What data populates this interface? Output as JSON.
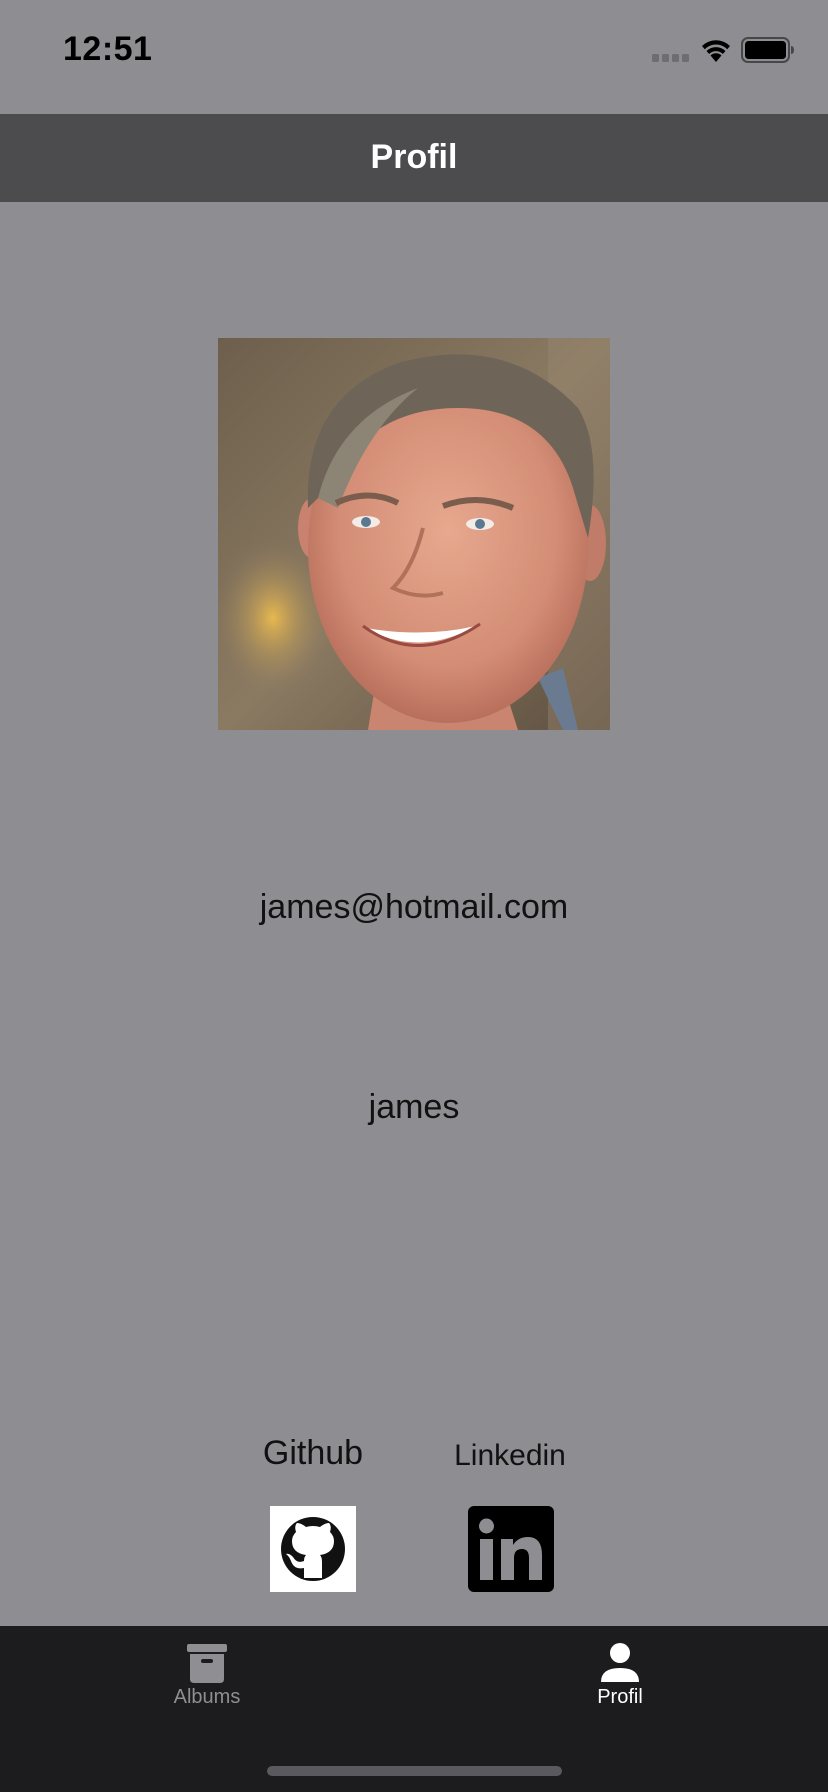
{
  "status_bar": {
    "time": "12:51"
  },
  "nav": {
    "title": "Profil"
  },
  "profile": {
    "email": "james@hotmail.com",
    "name": "james"
  },
  "social": {
    "github_label": "Github",
    "linkedin_label": "Linkedin"
  },
  "tabs": [
    {
      "label": "Albums",
      "icon": "archive-box-icon",
      "selected": false
    },
    {
      "label": "Profil",
      "icon": "person-icon",
      "selected": true
    }
  ],
  "colors": {
    "background": "#8e8d92",
    "nav_bar": "#4c4c4e",
    "tab_bar": "#1c1c1e",
    "tab_inactive": "#8e8e93",
    "tab_active": "#ffffff"
  }
}
